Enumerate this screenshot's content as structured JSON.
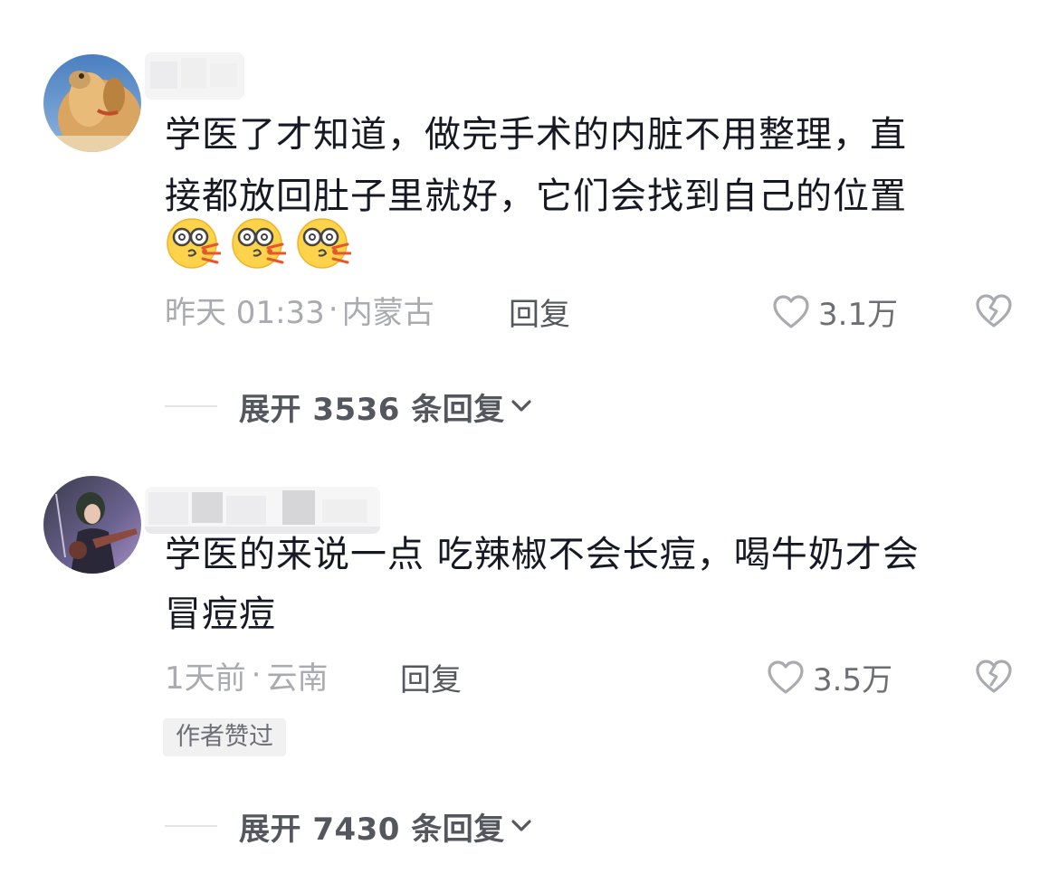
{
  "comments": [
    {
      "text_line1": "学医了才知道，做完手术的内脏不用整理，直",
      "text_line2": "接都放回肚子里就好，它们会找到自己的位置",
      "emoji_icons": [
        "dizzy-kiss-emoji",
        "dizzy-kiss-emoji",
        "dizzy-kiss-emoji"
      ],
      "time": "昨天 01:33",
      "separator": "·",
      "location": "内蒙古",
      "reply_label": "回复",
      "like_count": "3.1万",
      "expand_label": "展开 3536 条回复"
    },
    {
      "text_line1": "学医的来说一点 吃辣椒不会长痘，喝牛奶才会",
      "text_line2": "冒痘痘",
      "time": "1天前",
      "separator": "·",
      "location": "云南",
      "reply_label": "回复",
      "like_count": "3.5万",
      "badge": "作者赞过",
      "expand_label": "展开 7430 条回复"
    }
  ],
  "colors": {
    "text": "#161823",
    "meta": "#a9abb0",
    "secondary": "#55575e",
    "badge_bg": "#f1f1f2"
  }
}
